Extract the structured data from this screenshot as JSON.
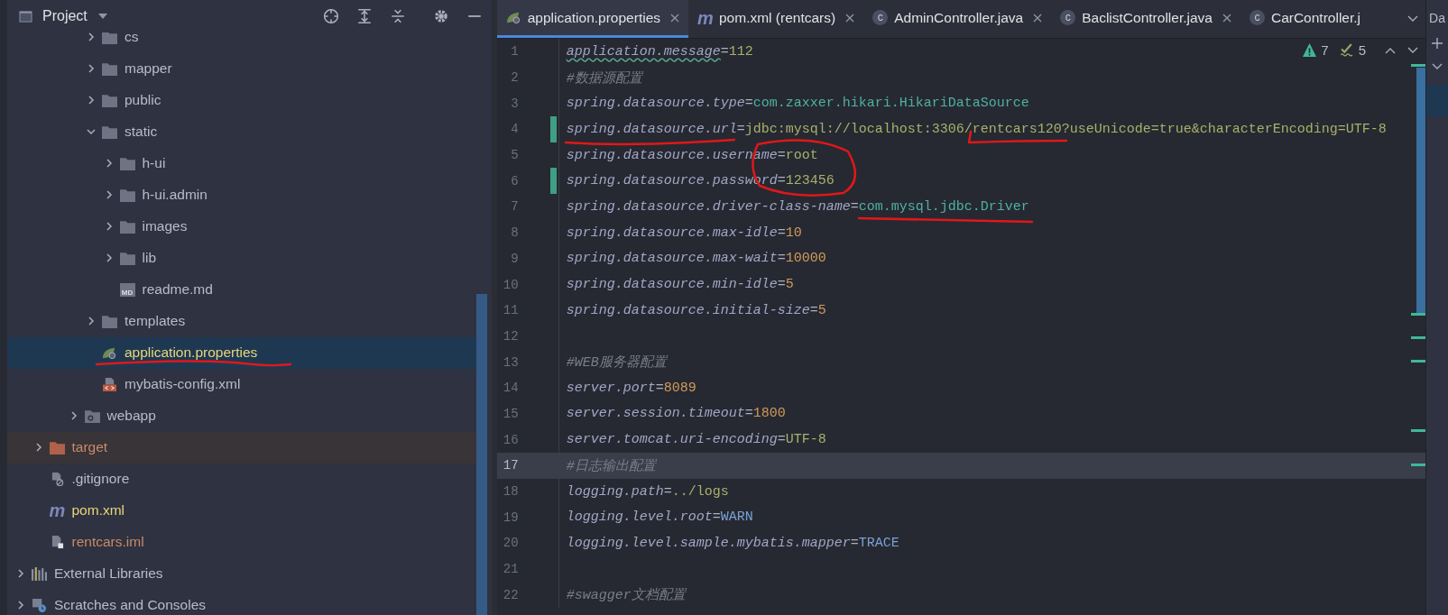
{
  "project": {
    "title": "Project",
    "tree": [
      {
        "children": [
          {
            "children": [
              {
                "children": [
                  {
                    "children": [
                      {
                        "label": "cs",
                        "kind": "folder",
                        "expanded": false,
                        "selected": false
                      },
                      {
                        "label": "mapper",
                        "kind": "folder",
                        "expanded": false,
                        "selected": false
                      },
                      {
                        "label": "public",
                        "kind": "folder",
                        "expanded": false,
                        "selected": false
                      },
                      {
                        "label": "static",
                        "kind": "folder",
                        "expanded": true,
                        "selected": false,
                        "children": [
                          {
                            "label": "h-ui",
                            "kind": "folder",
                            "expanded": false,
                            "selected": false
                          },
                          {
                            "label": "h-ui.admin",
                            "kind": "folder",
                            "expanded": false,
                            "selected": false
                          },
                          {
                            "label": "images",
                            "kind": "folder",
                            "expanded": false,
                            "selected": false
                          },
                          {
                            "label": "lib",
                            "kind": "folder",
                            "expanded": false,
                            "selected": false
                          },
                          {
                            "label": "readme.md",
                            "kind": "markdown",
                            "icon_text": "MD",
                            "selected": false
                          }
                        ]
                      },
                      {
                        "label": "templates",
                        "kind": "folder",
                        "expanded": false,
                        "selected": false
                      },
                      {
                        "label": "application.properties",
                        "kind": "spring",
                        "selected": true,
                        "color": "#e8d77a"
                      },
                      {
                        "label": "mybatis-config.xml",
                        "kind": "xml",
                        "selected": false
                      }
                    ]
                  },
                  {
                    "label": "webapp",
                    "kind": "web",
                    "expanded": false,
                    "selected": false
                  }
                ]
              }
            ]
          },
          {
            "label": "target",
            "kind": "excluded",
            "expanded": false,
            "selected": false,
            "color": "#c98a6a"
          },
          {
            "label": ".gitignore",
            "kind": "ignore",
            "selected": false
          },
          {
            "label": "pom.xml",
            "kind": "maven",
            "icon_text": "m",
            "selected": false,
            "color": "#e8d77a"
          },
          {
            "label": "rentcars.iml",
            "kind": "module",
            "selected": false,
            "color": "#c98a6a"
          }
        ]
      },
      {
        "label": "External Libraries",
        "kind": "libraries",
        "expanded": false,
        "selected": false
      },
      {
        "label": "Scratches and Consoles",
        "kind": "scratches",
        "expanded": false,
        "selected": false
      }
    ]
  },
  "tabs": [
    {
      "label": "application.properties",
      "kind": "spring",
      "selected": true,
      "closable": true
    },
    {
      "label": "pom.xml (rentcars)",
      "kind": "maven",
      "icon_text": "m",
      "selected": false,
      "closable": true
    },
    {
      "label": "AdminController.java",
      "kind": "class",
      "icon_text": "c",
      "selected": false,
      "closable": true
    },
    {
      "label": "BaclistController.java",
      "kind": "class",
      "icon_text": "c",
      "selected": false,
      "closable": true
    },
    {
      "label": "CarController.j",
      "kind": "class",
      "icon_text": "c",
      "selected": false,
      "closable": false
    }
  ],
  "inspections": {
    "warnings": "7",
    "weak_warnings": "5"
  },
  "lines": [
    {
      "number": "1",
      "current": false,
      "changed": false,
      "tokens": [
        {
          "kind": "key",
          "text": "application.message",
          "typo": true
        },
        {
          "kind": "sign",
          "text": "="
        },
        {
          "kind": "string",
          "text": "112"
        }
      ]
    },
    {
      "number": "2",
      "current": false,
      "changed": false,
      "tokens": [
        {
          "kind": "comment",
          "text": "#数据源配置"
        }
      ]
    },
    {
      "number": "3",
      "current": false,
      "changed": false,
      "tokens": [
        {
          "kind": "key",
          "text": "spring.datasource.type"
        },
        {
          "kind": "sign",
          "text": "="
        },
        {
          "kind": "class",
          "text": "com.zaxxer.hikari.HikariDataSource"
        }
      ]
    },
    {
      "number": "4",
      "current": false,
      "changed": true,
      "tokens": [
        {
          "kind": "key",
          "text": "spring.datasource.url"
        },
        {
          "kind": "sign",
          "text": "="
        },
        {
          "kind": "string",
          "text": "jdbc:mysql://localhost:3306/rentcars120?useUnicode=true&characterEncoding=UTF-8"
        }
      ]
    },
    {
      "number": "5",
      "current": false,
      "changed": false,
      "tokens": [
        {
          "kind": "key",
          "text": "spring.datasource.username"
        },
        {
          "kind": "sign",
          "text": "="
        },
        {
          "kind": "string",
          "text": "root"
        }
      ]
    },
    {
      "number": "6",
      "current": false,
      "changed": true,
      "tokens": [
        {
          "kind": "key",
          "text": "spring.datasource.password"
        },
        {
          "kind": "sign",
          "text": "="
        },
        {
          "kind": "string",
          "text": "123456"
        }
      ]
    },
    {
      "number": "7",
      "current": false,
      "changed": false,
      "tokens": [
        {
          "kind": "key",
          "text": "spring.datasource.driver-class-name"
        },
        {
          "kind": "sign",
          "text": "="
        },
        {
          "kind": "class",
          "text": "com.mysql.jdbc.Driver"
        }
      ]
    },
    {
      "number": "8",
      "current": false,
      "changed": false,
      "tokens": [
        {
          "kind": "key",
          "text": "spring.datasource.max-idle"
        },
        {
          "kind": "sign",
          "text": "="
        },
        {
          "kind": "number",
          "text": "10"
        }
      ]
    },
    {
      "number": "9",
      "current": false,
      "changed": false,
      "tokens": [
        {
          "kind": "key",
          "text": "spring.datasource.max-wait"
        },
        {
          "kind": "sign",
          "text": "="
        },
        {
          "kind": "number",
          "text": "10000"
        }
      ]
    },
    {
      "number": "10",
      "current": false,
      "changed": false,
      "tokens": [
        {
          "kind": "key",
          "text": "spring.datasource.min-idle"
        },
        {
          "kind": "sign",
          "text": "="
        },
        {
          "kind": "number",
          "text": "5"
        }
      ]
    },
    {
      "number": "11",
      "current": false,
      "changed": false,
      "tokens": [
        {
          "kind": "key",
          "text": "spring.datasource.initial-size"
        },
        {
          "kind": "sign",
          "text": "="
        },
        {
          "kind": "number",
          "text": "5"
        }
      ]
    },
    {
      "number": "12",
      "current": false,
      "changed": false
    },
    {
      "number": "13",
      "current": false,
      "changed": false,
      "tokens": [
        {
          "kind": "comment",
          "text": "#WEB服务器配置"
        }
      ]
    },
    {
      "number": "14",
      "current": false,
      "changed": false,
      "tokens": [
        {
          "kind": "key",
          "text": "server.port"
        },
        {
          "kind": "sign",
          "text": "="
        },
        {
          "kind": "number",
          "text": "8089"
        }
      ]
    },
    {
      "number": "15",
      "current": false,
      "changed": false,
      "tokens": [
        {
          "kind": "key",
          "text": "server.session.timeout"
        },
        {
          "kind": "sign",
          "text": "="
        },
        {
          "kind": "number",
          "text": "1800"
        }
      ]
    },
    {
      "number": "16",
      "current": false,
      "changed": false,
      "tokens": [
        {
          "kind": "key",
          "text": "server.tomcat.uri-encoding"
        },
        {
          "kind": "sign",
          "text": "="
        },
        {
          "kind": "string",
          "text": "UTF-8"
        }
      ]
    },
    {
      "number": "17",
      "current": true,
      "changed": false,
      "tokens": [
        {
          "kind": "comment",
          "text": "#日志输出配置"
        }
      ]
    },
    {
      "number": "18",
      "current": false,
      "changed": false,
      "tokens": [
        {
          "kind": "key",
          "text": "logging.path"
        },
        {
          "kind": "sign",
          "text": "="
        },
        {
          "kind": "string",
          "text": "../logs"
        }
      ]
    },
    {
      "number": "19",
      "current": false,
      "changed": false,
      "tokens": [
        {
          "kind": "key",
          "text": "logging.level.root"
        },
        {
          "kind": "sign",
          "text": "="
        },
        {
          "kind": "enum",
          "text": "WARN"
        }
      ]
    },
    {
      "number": "20",
      "current": false,
      "changed": false,
      "tokens": [
        {
          "kind": "key",
          "text": "logging.level.sample.mybatis.mapper"
        },
        {
          "kind": "sign",
          "text": "="
        },
        {
          "kind": "enum",
          "text": "TRACE"
        }
      ]
    },
    {
      "number": "21",
      "current": false,
      "changed": false
    },
    {
      "number": "22",
      "current": false,
      "changed": false,
      "tokens": [
        {
          "kind": "comment",
          "text": "#swagger文档配置"
        }
      ]
    }
  ],
  "side_panel": {
    "title": "Da"
  }
}
